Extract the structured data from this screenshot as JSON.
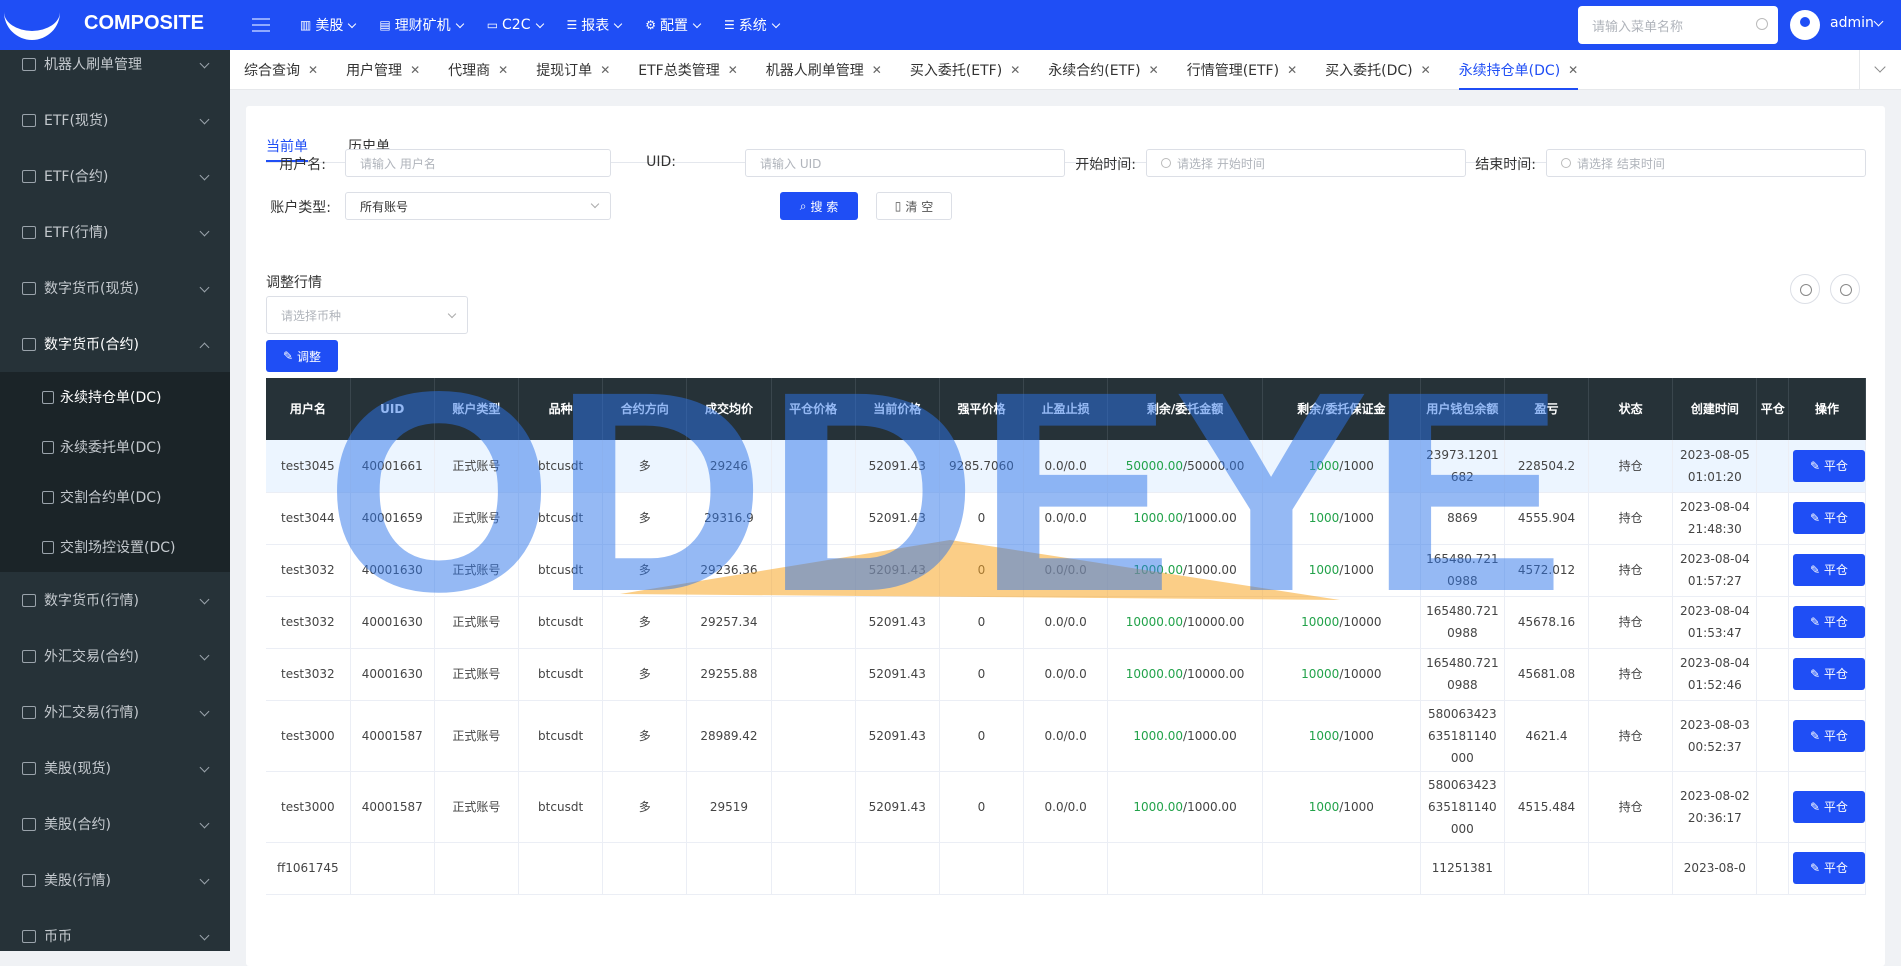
{
  "app": {
    "logo_text": "COMPOSITE"
  },
  "sidebar": {
    "items": [
      {
        "label": "机器人刷单管理",
        "icon": "robot-icon"
      },
      {
        "label": "ETF(现货)",
        "icon": "etf-icon"
      },
      {
        "label": "ETF(合约)",
        "icon": "contract-icon"
      },
      {
        "label": "ETF(行情)",
        "icon": "edit-icon"
      },
      {
        "label": "数字货币(现货)",
        "icon": "coin-icon"
      },
      {
        "label": "数字货币(合约)",
        "icon": "contract-icon",
        "expanded": true
      },
      {
        "label": "数字货币(行情)",
        "icon": "edit-icon"
      },
      {
        "label": "外汇交易(合约)",
        "icon": "document-icon"
      },
      {
        "label": "外汇交易(行情)",
        "icon": "edit-icon"
      },
      {
        "label": "美股(现货)",
        "icon": "coin-icon"
      },
      {
        "label": "美股(合约)",
        "icon": "contract-icon"
      },
      {
        "label": "美股(行情)",
        "icon": "edit-icon"
      },
      {
        "label": "币币",
        "icon": "coin-icon"
      }
    ],
    "sub_items": [
      {
        "label": "永续持仓单(DC)",
        "active": true
      },
      {
        "label": "永续委托单(DC)"
      },
      {
        "label": "交割合约单(DC)"
      },
      {
        "label": "交割场控设置(DC)"
      }
    ]
  },
  "topnav": {
    "items": [
      "美股",
      "理财矿机",
      "C2C",
      "报表",
      "配置",
      "系统"
    ],
    "search_placeholder": "请输入菜单名称",
    "user": "admin"
  },
  "tabs": [
    "综合查询",
    "用户管理",
    "代理商",
    "提现订单",
    "ETF总类管理",
    "机器人刷单管理",
    "买入委托(ETF)",
    "永续合约(ETF)",
    "行情管理(ETF)",
    "买入委托(DC)",
    "永续持仓单(DC)"
  ],
  "active_tab": "永续持仓单(DC)",
  "subtabs": {
    "current": "当前单",
    "history": "历史单"
  },
  "filters": {
    "username_label": "用户名:",
    "username_placeholder": "请输入 用户名",
    "uid_label": "UID:",
    "uid_placeholder": "请输入 UID",
    "start_label": "开始时间:",
    "start_placeholder": "请选择 开始时间",
    "end_label": "结束时间:",
    "end_placeholder": "请选择 结束时间",
    "account_label": "账户类型:",
    "account_value": "所有账号",
    "search_btn": "搜 索",
    "clear_btn": "清 空"
  },
  "adjust": {
    "label": "调整行情",
    "select_placeholder": "请选择币种",
    "btn": "调整"
  },
  "table": {
    "headers": [
      "用户名",
      "UID",
      "账户类型",
      "品种",
      "合约方向",
      "成交均价",
      "平仓价格",
      "当前价格",
      "强平价格",
      "止盈止损",
      "剩余/委托金额",
      "剩余/委托保证金",
      "用户钱包余额",
      "盈亏",
      "状态",
      "创建时间",
      "平仓",
      "操作"
    ],
    "rows": [
      {
        "user": "test3045",
        "uid": "40001661",
        "acct": "正式账号",
        "sym": "btcusdt",
        "dir": "多",
        "avg": "29246",
        "close": "",
        "cur": "52091.43",
        "liq": "9285.7060",
        "tpsl": "0.0/0.0",
        "amt_r": "50000.00",
        "amt_t": "/50000.00",
        "mg_r": "1000",
        "mg_t": "/1000",
        "bal": "23973.1201682",
        "pnl": "228504.2",
        "status": "持仓",
        "time": "2023-08-05 01:01:20",
        "op": "平仓"
      },
      {
        "user": "test3044",
        "uid": "40001659",
        "acct": "正式账号",
        "sym": "btcusdt",
        "dir": "多",
        "avg": "29316.9",
        "close": "",
        "cur": "52091.43",
        "liq": "0",
        "tpsl": "0.0/0.0",
        "amt_r": "1000.00",
        "amt_t": "/1000.00",
        "mg_r": "1000",
        "mg_t": "/1000",
        "bal": "8869",
        "pnl": "4555.904",
        "status": "持仓",
        "time": "2023-08-04 21:48:30",
        "op": "平仓"
      },
      {
        "user": "test3032",
        "uid": "40001630",
        "acct": "正式账号",
        "sym": "btcusdt",
        "dir": "多",
        "avg": "29236.36",
        "close": "",
        "cur": "52091.43",
        "liq": "0",
        "tpsl": "0.0/0.0",
        "amt_r": "1000.00",
        "amt_t": "/1000.00",
        "mg_r": "1000",
        "mg_t": "/1000",
        "bal": "165480.7210988",
        "pnl": "4572.012",
        "status": "持仓",
        "time": "2023-08-04 01:57:27",
        "op": "平仓"
      },
      {
        "user": "test3032",
        "uid": "40001630",
        "acct": "正式账号",
        "sym": "btcusdt",
        "dir": "多",
        "avg": "29257.34",
        "close": "",
        "cur": "52091.43",
        "liq": "0",
        "tpsl": "0.0/0.0",
        "amt_r": "10000.00",
        "amt_t": "/10000.00",
        "mg_r": "10000",
        "mg_t": "/10000",
        "bal": "165480.7210988",
        "pnl": "45678.16",
        "status": "持仓",
        "time": "2023-08-04 01:53:47",
        "op": "平仓"
      },
      {
        "user": "test3032",
        "uid": "40001630",
        "acct": "正式账号",
        "sym": "btcusdt",
        "dir": "多",
        "avg": "29255.88",
        "close": "",
        "cur": "52091.43",
        "liq": "0",
        "tpsl": "0.0/0.0",
        "amt_r": "10000.00",
        "amt_t": "/10000.00",
        "mg_r": "10000",
        "mg_t": "/10000",
        "bal": "165480.7210988",
        "pnl": "45681.08",
        "status": "持仓",
        "time": "2023-08-04 01:52:46",
        "op": "平仓"
      },
      {
        "user": "test3000",
        "uid": "40001587",
        "acct": "正式账号",
        "sym": "btcusdt",
        "dir": "多",
        "avg": "28989.42",
        "close": "",
        "cur": "52091.43",
        "liq": "0",
        "tpsl": "0.0/0.0",
        "amt_r": "1000.00",
        "amt_t": "/1000.00",
        "mg_r": "1000",
        "mg_t": "/1000",
        "bal": "580063423635181140000",
        "pnl": "4621.4",
        "status": "持仓",
        "time": "2023-08-03 00:52:37",
        "op": "平仓"
      },
      {
        "user": "test3000",
        "uid": "40001587",
        "acct": "正式账号",
        "sym": "btcusdt",
        "dir": "多",
        "avg": "29519",
        "close": "",
        "cur": "52091.43",
        "liq": "0",
        "tpsl": "0.0/0.0",
        "amt_r": "1000.00",
        "amt_t": "/1000.00",
        "mg_r": "1000",
        "mg_t": "/1000",
        "bal": "580063423635181140000",
        "pnl": "4515.484",
        "status": "持仓",
        "time": "2023-08-02 20:36:17",
        "op": "平仓"
      },
      {
        "user": "ff1061745",
        "uid": "",
        "acct": "",
        "sym": "",
        "dir": "",
        "avg": "",
        "close": "",
        "cur": "",
        "liq": "",
        "tpsl": "",
        "amt_r": "",
        "amt_t": "",
        "mg_r": "",
        "mg_t": "",
        "bal": "11251381",
        "pnl": "",
        "status": "",
        "time": "2023-08-0",
        "op": "平仓"
      }
    ]
  },
  "watermark": {
    "text": "ODDEYE"
  },
  "colors": {
    "primary": "#1f4ef5",
    "sidebar": "#263238",
    "profit": "#22a24a",
    "link": "#1f6fd8"
  }
}
